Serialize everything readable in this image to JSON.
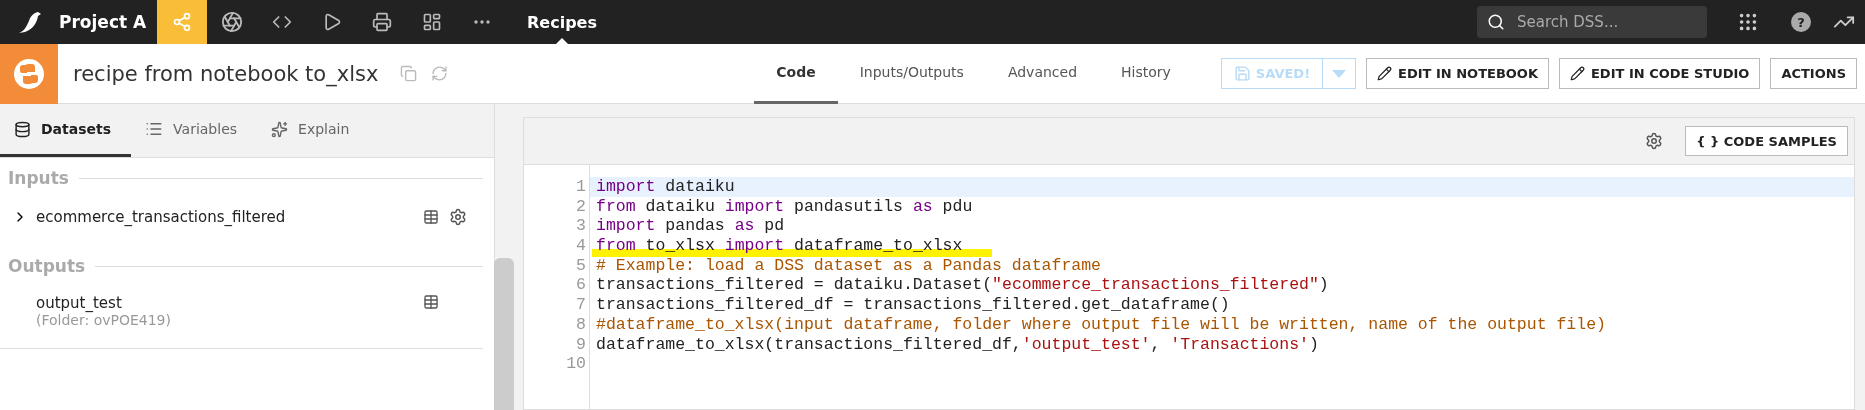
{
  "top_bar": {
    "project": "Project A",
    "nav_items": [
      {
        "kind": "flow",
        "selected": true
      },
      {
        "kind": "lab",
        "selected": false
      },
      {
        "kind": "code",
        "selected": false
      },
      {
        "kind": "run",
        "selected": false
      },
      {
        "kind": "stack",
        "selected": false
      },
      {
        "kind": "dashboard",
        "selected": false
      },
      {
        "kind": "more",
        "selected": false
      }
    ],
    "section": "Recipes",
    "search": {
      "placeholder": "Search DSS..."
    },
    "help": "?"
  },
  "recipe_header": {
    "title": "recipe from notebook to_xlsx",
    "tabs": [
      {
        "label": "Code",
        "selected": true
      },
      {
        "label": "Inputs/Outputs",
        "selected": false
      },
      {
        "label": "Advanced",
        "selected": false
      },
      {
        "label": "History",
        "selected": false
      }
    ],
    "save_button": {
      "label": "SAVED!",
      "disabled": true
    },
    "buttons": [
      {
        "label": "EDIT IN NOTEBOOK",
        "kind": "pencil"
      },
      {
        "label": "EDIT IN CODE STUDIO",
        "kind": "pencil"
      },
      {
        "label": "ACTIONS",
        "kind": "plain"
      }
    ]
  },
  "left_panel": {
    "tabs": [
      {
        "label": "Datasets",
        "kind": "database",
        "selected": true
      },
      {
        "label": "Variables",
        "kind": "list",
        "selected": false
      },
      {
        "label": "Explain",
        "kind": "sparkles",
        "selected": false
      }
    ],
    "inputs": {
      "heading": "Inputs",
      "items": [
        {
          "name": "ecommerce_transactions_filtered",
          "expanded": false
        }
      ]
    },
    "outputs": {
      "heading": "Outputs",
      "items": [
        {
          "name": "output_test",
          "detail": "(Folder: ovPOE419)"
        }
      ]
    }
  },
  "editor": {
    "samples_button": {
      "braces": "{ }",
      "label": "CODE SAMPLES"
    },
    "lines": [
      {
        "number": "1",
        "active": true,
        "marked": false,
        "tokens": [
          {
            "t": "import",
            "color": "#770088"
          },
          {
            "t": " dataiku",
            "color": "#222222"
          }
        ]
      },
      {
        "number": "2",
        "active": false,
        "marked": false,
        "tokens": [
          {
            "t": "from",
            "color": "#770088"
          },
          {
            "t": " dataiku ",
            "color": "#222222"
          },
          {
            "t": "import",
            "color": "#770088"
          },
          {
            "t": " pandasutils ",
            "color": "#222222"
          },
          {
            "t": "as",
            "color": "#770088"
          },
          {
            "t": " pdu",
            "color": "#222222"
          }
        ]
      },
      {
        "number": "3",
        "active": false,
        "marked": false,
        "tokens": [
          {
            "t": "import",
            "color": "#770088"
          },
          {
            "t": " pandas ",
            "color": "#222222"
          },
          {
            "t": "as",
            "color": "#770088"
          },
          {
            "t": " pd",
            "color": "#222222"
          }
        ]
      },
      {
        "number": "4",
        "active": false,
        "marked": true,
        "tokens": [
          {
            "t": "from",
            "color": "#770088"
          },
          {
            "t": " to_xlsx ",
            "color": "#222222"
          },
          {
            "t": "import",
            "color": "#770088"
          },
          {
            "t": " dataframe_to_xlsx",
            "color": "#222222"
          }
        ]
      },
      {
        "number": "5",
        "active": false,
        "marked": false,
        "tokens": [
          {
            "t": "# Example: load a DSS dataset as a Pandas dataframe",
            "color": "#aa5500"
          }
        ]
      },
      {
        "number": "6",
        "active": false,
        "marked": false,
        "tokens": [
          {
            "t": "transactions_filtered = dataiku.Dataset(",
            "color": "#222222"
          },
          {
            "t": "\"ecommerce_transactions_filtered\"",
            "color": "#aa1111"
          },
          {
            "t": ")",
            "color": "#222222"
          }
        ]
      },
      {
        "number": "7",
        "active": false,
        "marked": false,
        "tokens": [
          {
            "t": "transactions_filtered_df = transactions_filtered.get_dataframe()",
            "color": "#222222"
          }
        ]
      },
      {
        "number": "8",
        "active": false,
        "marked": false,
        "tokens": [
          {
            "t": "#dataframe_to_xlsx(input dataframe, folder where output file will be written, name of the output file)",
            "color": "#aa5500"
          }
        ]
      },
      {
        "number": "9",
        "active": false,
        "marked": false,
        "tokens": [
          {
            "t": "dataframe_to_xlsx(transactions_filtered_df,",
            "color": "#222222"
          },
          {
            "t": "'output_test'",
            "color": "#aa1111"
          },
          {
            "t": ", ",
            "color": "#222222"
          },
          {
            "t": "'Transactions'",
            "color": "#aa1111"
          },
          {
            "t": ")",
            "color": "#222222"
          }
        ]
      },
      {
        "number": "10",
        "active": false,
        "marked": false
      }
    ]
  }
}
